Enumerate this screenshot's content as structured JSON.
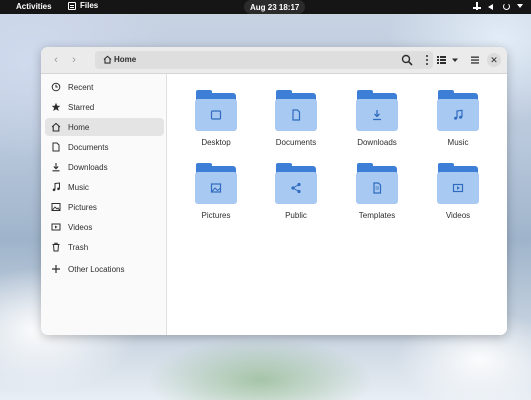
{
  "topbar": {
    "activities": "Activities",
    "app_name": "Files",
    "clock": "Aug 23  18:17"
  },
  "window": {
    "path": "Home"
  },
  "sidebar": {
    "items": [
      {
        "label": "Recent",
        "icon": "clock-icon"
      },
      {
        "label": "Starred",
        "icon": "star-icon"
      },
      {
        "label": "Home",
        "icon": "home-icon",
        "active": true
      },
      {
        "label": "Documents",
        "icon": "document-icon"
      },
      {
        "label": "Downloads",
        "icon": "download-icon"
      },
      {
        "label": "Music",
        "icon": "music-icon"
      },
      {
        "label": "Pictures",
        "icon": "picture-icon"
      },
      {
        "label": "Videos",
        "icon": "video-icon"
      },
      {
        "label": "Trash",
        "icon": "trash-icon"
      }
    ],
    "other_locations": "Other Locations"
  },
  "folders": [
    {
      "label": "Desktop",
      "icon": "folder-icon"
    },
    {
      "label": "Documents",
      "icon": "document-icon"
    },
    {
      "label": "Downloads",
      "icon": "download-icon"
    },
    {
      "label": "Music",
      "icon": "music-icon"
    },
    {
      "label": "Pictures",
      "icon": "picture-icon"
    },
    {
      "label": "Public",
      "icon": "share-icon"
    },
    {
      "label": "Templates",
      "icon": "template-icon"
    },
    {
      "label": "Videos",
      "icon": "video-icon"
    }
  ],
  "colors": {
    "folder_dark": "#3d7fd6",
    "folder_light": "#a8c9f1",
    "topbar": "#151515"
  }
}
